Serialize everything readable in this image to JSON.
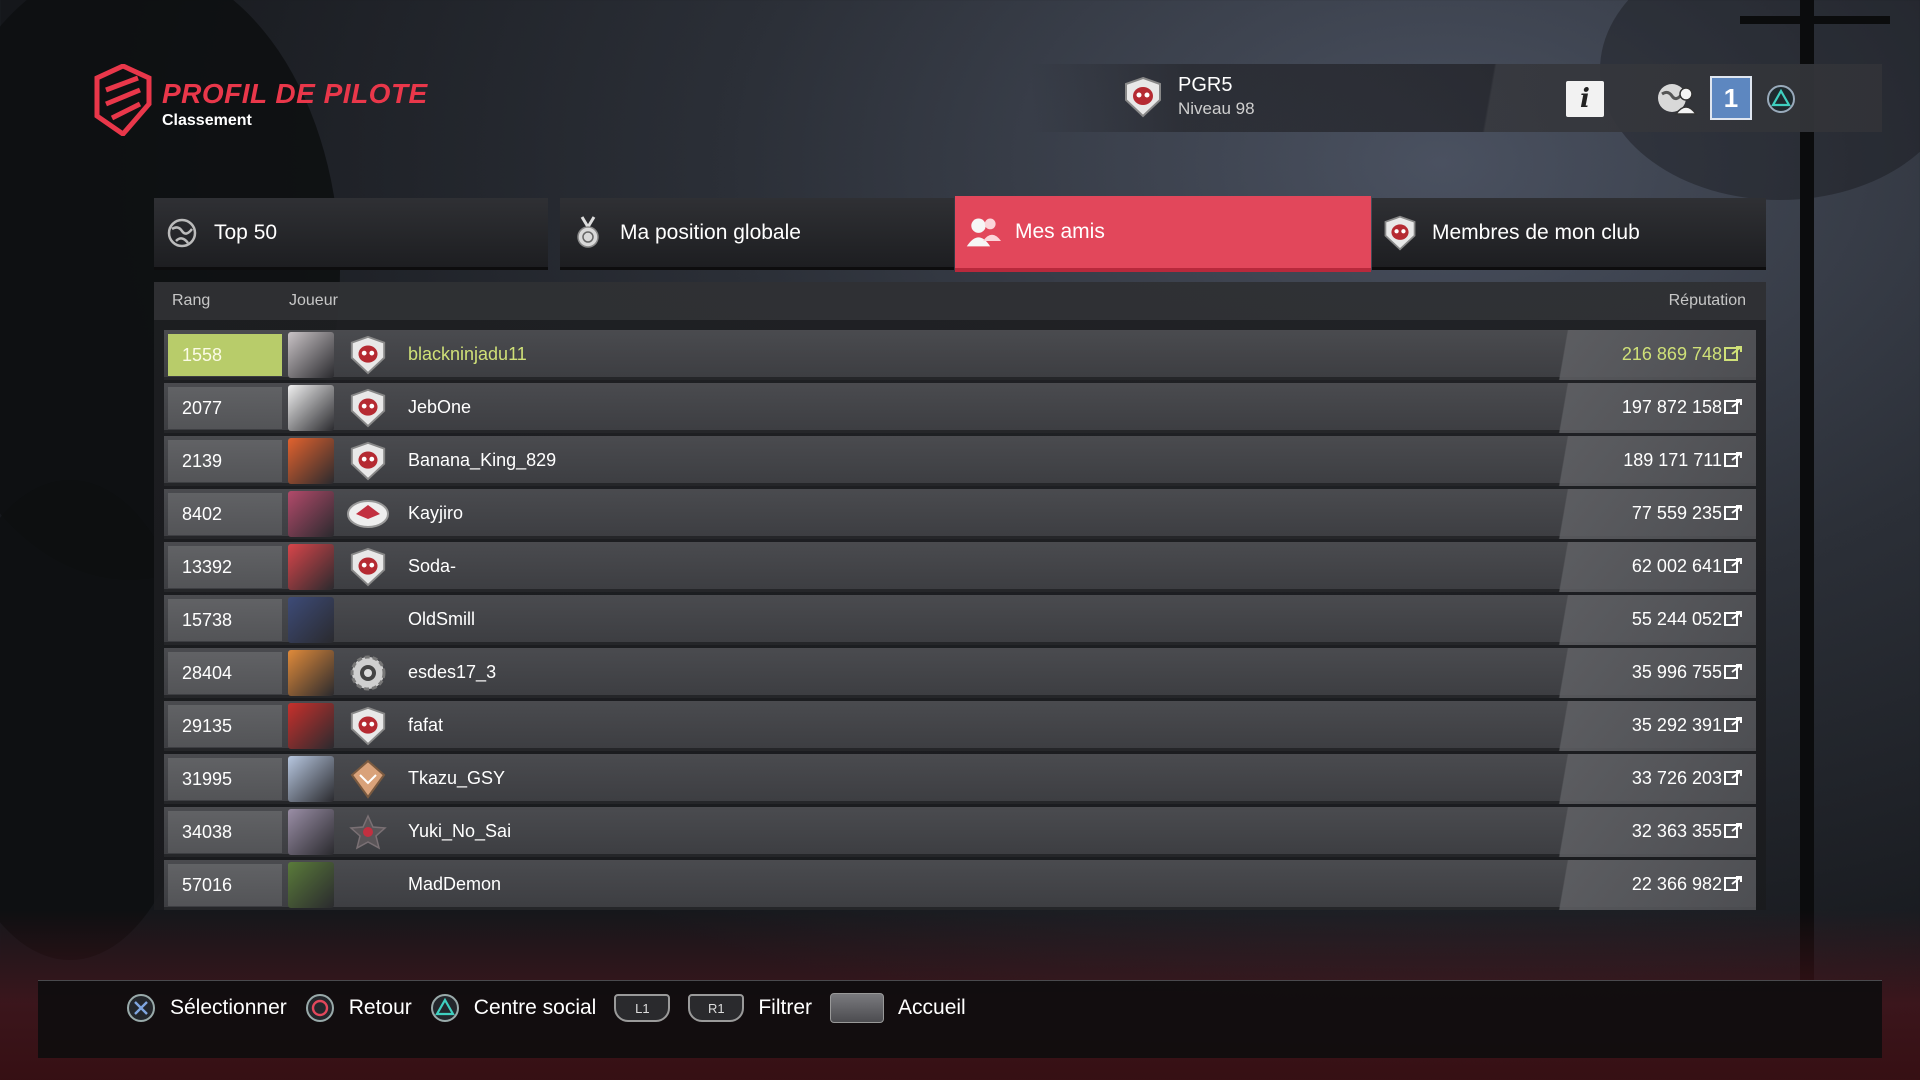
{
  "header": {
    "title": "PROFIL DE PILOTE",
    "subtitle": "Classement",
    "brand_color": "#e9374a"
  },
  "profile": {
    "name": "PGR5",
    "level": "Niveau 98",
    "emblem_icon": "club-skull-emblem-icon"
  },
  "topbar": {
    "info_icon": "i",
    "friends_icon": "friends-world-icon",
    "notification_count": "1",
    "triangle_icon": "triangle-button-icon"
  },
  "tabs": [
    {
      "label": "Top 50",
      "icon": "globe-icon",
      "active": false
    },
    {
      "label": "Ma position globale",
      "icon": "medal-icon",
      "active": false
    },
    {
      "label": "Mes amis",
      "icon": "friends-icon",
      "active": true
    },
    {
      "label": "Membres de mon club",
      "icon": "club-emblem-icon",
      "active": false
    }
  ],
  "table": {
    "headers": {
      "rank": "Rang",
      "player": "Joueur",
      "reputation": "Réputation"
    },
    "rows": [
      {
        "rank": "1558",
        "name": "blackninjadu11",
        "reputation": "216 869 748",
        "highlight": true,
        "avatar_color": "#c9c3c6",
        "club": "skull"
      },
      {
        "rank": "2077",
        "name": "JebOne",
        "reputation": "197 872 158",
        "highlight": false,
        "avatar_color": "#f0f0f0",
        "club": "skull"
      },
      {
        "rank": "2139",
        "name": "Banana_King_829",
        "reputation": "189 171 711",
        "highlight": false,
        "avatar_color": "#e2622e",
        "club": "skull"
      },
      {
        "rank": "8402",
        "name": "Kayjiro",
        "reputation": "77 559 235",
        "highlight": false,
        "avatar_color": "#b24a6a",
        "club": "cap"
      },
      {
        "rank": "13392",
        "name": "Soda-",
        "reputation": "62 002 641",
        "highlight": false,
        "avatar_color": "#d8454a",
        "club": "skull"
      },
      {
        "rank": "15738",
        "name": "OldSmill",
        "reputation": "55 244 052",
        "highlight": false,
        "avatar_color": "#3d4b78",
        "club": "none"
      },
      {
        "rank": "28404",
        "name": "esdes17_3",
        "reputation": "35 996 755",
        "highlight": false,
        "avatar_color": "#e08a3a",
        "club": "gear"
      },
      {
        "rank": "29135",
        "name": "fafat",
        "reputation": "35 292 391",
        "highlight": false,
        "avatar_color": "#c8302c",
        "club": "skull"
      },
      {
        "rank": "31995",
        "name": "Tkazu_GSY",
        "reputation": "33 726 203",
        "highlight": false,
        "avatar_color": "#b7c7e0",
        "club": "kite"
      },
      {
        "rank": "34038",
        "name": "Yuki_No_Sai",
        "reputation": "32 363 355",
        "highlight": false,
        "avatar_color": "#9a8ea6",
        "club": "star"
      },
      {
        "rank": "57016",
        "name": "MadDemon",
        "reputation": "22 366 982",
        "highlight": false,
        "avatar_color": "#5a7b3a",
        "club": "none"
      }
    ]
  },
  "footer": {
    "select": "Sélectionner",
    "back": "Retour",
    "social": "Centre social",
    "l1": "L1",
    "r1": "R1",
    "filter": "Filtrer",
    "home": "Accueil"
  }
}
